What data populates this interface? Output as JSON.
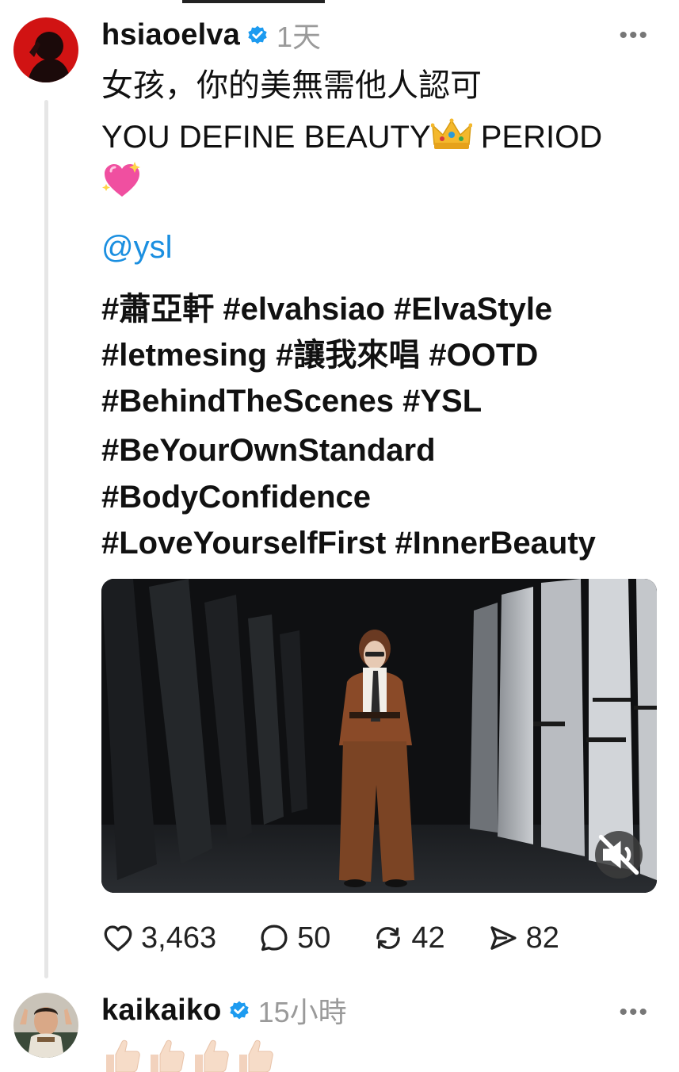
{
  "post": {
    "username": "hsiaoelva",
    "time": "1天",
    "lines": [
      "女孩，你的美無需他人認可",
      "YOU DEFINE BEAUTY",
      "PERIOD"
    ],
    "mention": "@ysl",
    "hashtag_lines": [
      "#蕭亞軒 #elvahsiao #ElvaStyle",
      "#letmesing #讓我來唱 #OOTD",
      "#BehindTheScenes #YSL",
      "#BeYourOwnStandard",
      "#BodyConfidence",
      "#LoveYourselfFirst #InnerBeauty"
    ],
    "stats": {
      "likes": "3,463",
      "replies": "50",
      "reposts": "42",
      "shares": "82"
    }
  },
  "reply": {
    "username": "kaikaiko",
    "time": "15小時"
  },
  "icons": {
    "verified": "verified-badge-icon",
    "more": "more-options-icon",
    "crown": "crown-emoji",
    "heart_sparkle": "sparkling-heart-emoji",
    "mute": "muted-speaker-icon",
    "like": "heart-icon",
    "reply": "speech-bubble-icon",
    "repost": "repost-icon",
    "share": "send-icon",
    "thumbs": "thumbs-up-emoji"
  },
  "colors": {
    "verified": "#1d9bf0",
    "mention": "#1b8fe0",
    "muted_text": "#9a9a9a"
  }
}
